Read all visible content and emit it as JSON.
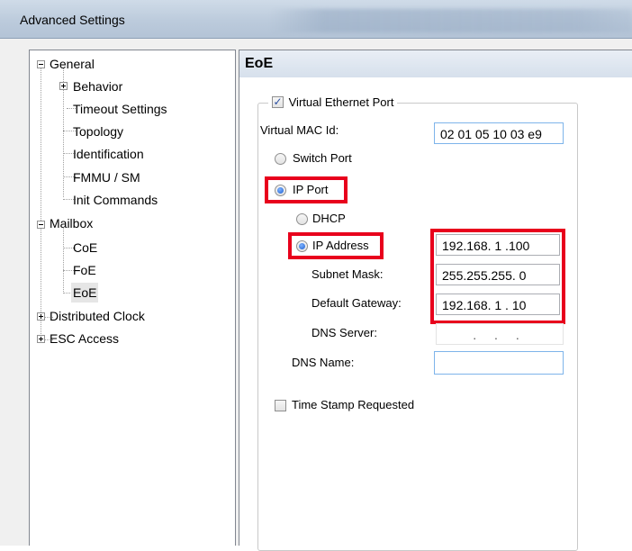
{
  "window": {
    "title": "Advanced Settings"
  },
  "tree": {
    "items": [
      {
        "label": "General",
        "expander": "minus"
      },
      {
        "label": "Behavior",
        "expander": "plus"
      },
      {
        "label": "Timeout Settings"
      },
      {
        "label": "Topology"
      },
      {
        "label": "Identification"
      },
      {
        "label": "FMMU / SM"
      },
      {
        "label": "Init Commands"
      },
      {
        "label": "Mailbox",
        "expander": "minus"
      },
      {
        "label": "CoE"
      },
      {
        "label": "FoE"
      },
      {
        "label": "EoE",
        "selected": true
      },
      {
        "label": "Distributed Clock",
        "expander": "plus"
      },
      {
        "label": "ESC Access",
        "expander": "plus"
      }
    ]
  },
  "panel": {
    "header": "EoE",
    "virtual_ethernet_port": {
      "label": "Virtual Ethernet Port",
      "checked": true
    },
    "virtual_mac": {
      "label": "Virtual MAC Id:",
      "value": "02 01 05 10 03 e9"
    },
    "switch_port": {
      "label": "Switch Port",
      "selected": false
    },
    "ip_port": {
      "label": "IP Port",
      "selected": true
    },
    "dhcp": {
      "label": "DHCP",
      "selected": false
    },
    "ip_address": {
      "label": "IP Address",
      "selected": true,
      "value": "192.168. 1 .100"
    },
    "subnet_mask": {
      "label": "Subnet Mask:",
      "value": "255.255.255. 0"
    },
    "default_gateway": {
      "label": "Default Gateway:",
      "value": "192.168. 1 . 10"
    },
    "dns_server": {
      "label": "DNS Server:",
      "value": ". . ."
    },
    "dns_name": {
      "label": "DNS Name:",
      "value": ""
    },
    "time_stamp": {
      "label": "Time Stamp Requested",
      "checked": false
    }
  },
  "colors": {
    "highlight": "#e8001c",
    "selection": "#e6e6e6",
    "header_gradient": "#d6e0ec"
  },
  "icons": {
    "checkbox_checked": "check-mark-icon",
    "tree_collapse": "minus-icon",
    "tree_expand": "plus-icon"
  }
}
